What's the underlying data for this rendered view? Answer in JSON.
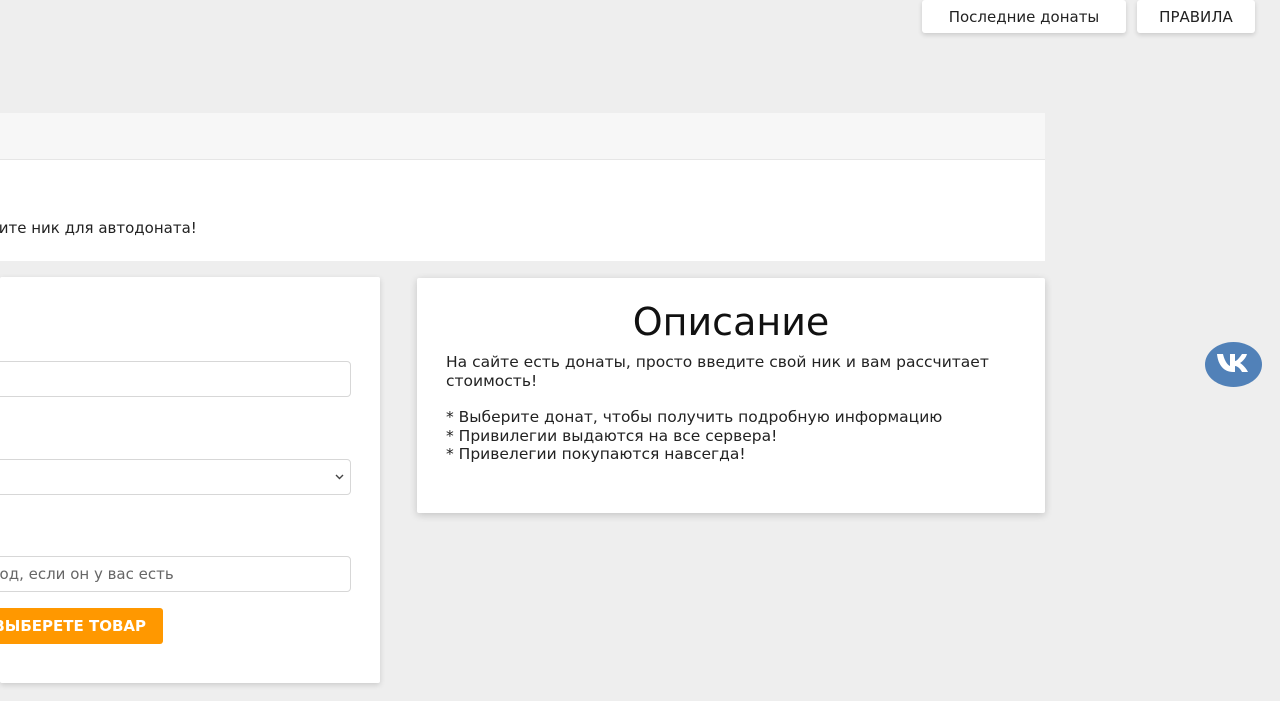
{
  "top_nav": {
    "last_donates_label": "Последние донаты",
    "rules_label": "ПРАВИЛА"
  },
  "header": {
    "message": "Введите ник для автодоната!"
  },
  "form": {
    "nick_value": "",
    "donate_selected": "",
    "promo_placeholder": "Промокод, если он у вас есть",
    "buy_button_label": "ВЫБЕРЕТЕ ТОВАР"
  },
  "description": {
    "title": "Описание",
    "intro": "На сайте есть донаты, просто введите свой ник и вам рассчитает стоимость!",
    "lines": [
      "* Выберите донат, чтобы получить подробную информацию",
      "* Привилегии выдаются на все сервера!",
      "* Привелегии покупаются навсегда!"
    ]
  },
  "social": {
    "vk_icon": "vk-icon"
  },
  "colors": {
    "background": "#eeeeee",
    "accent": "#ff9800",
    "vk": "#5181b8"
  }
}
